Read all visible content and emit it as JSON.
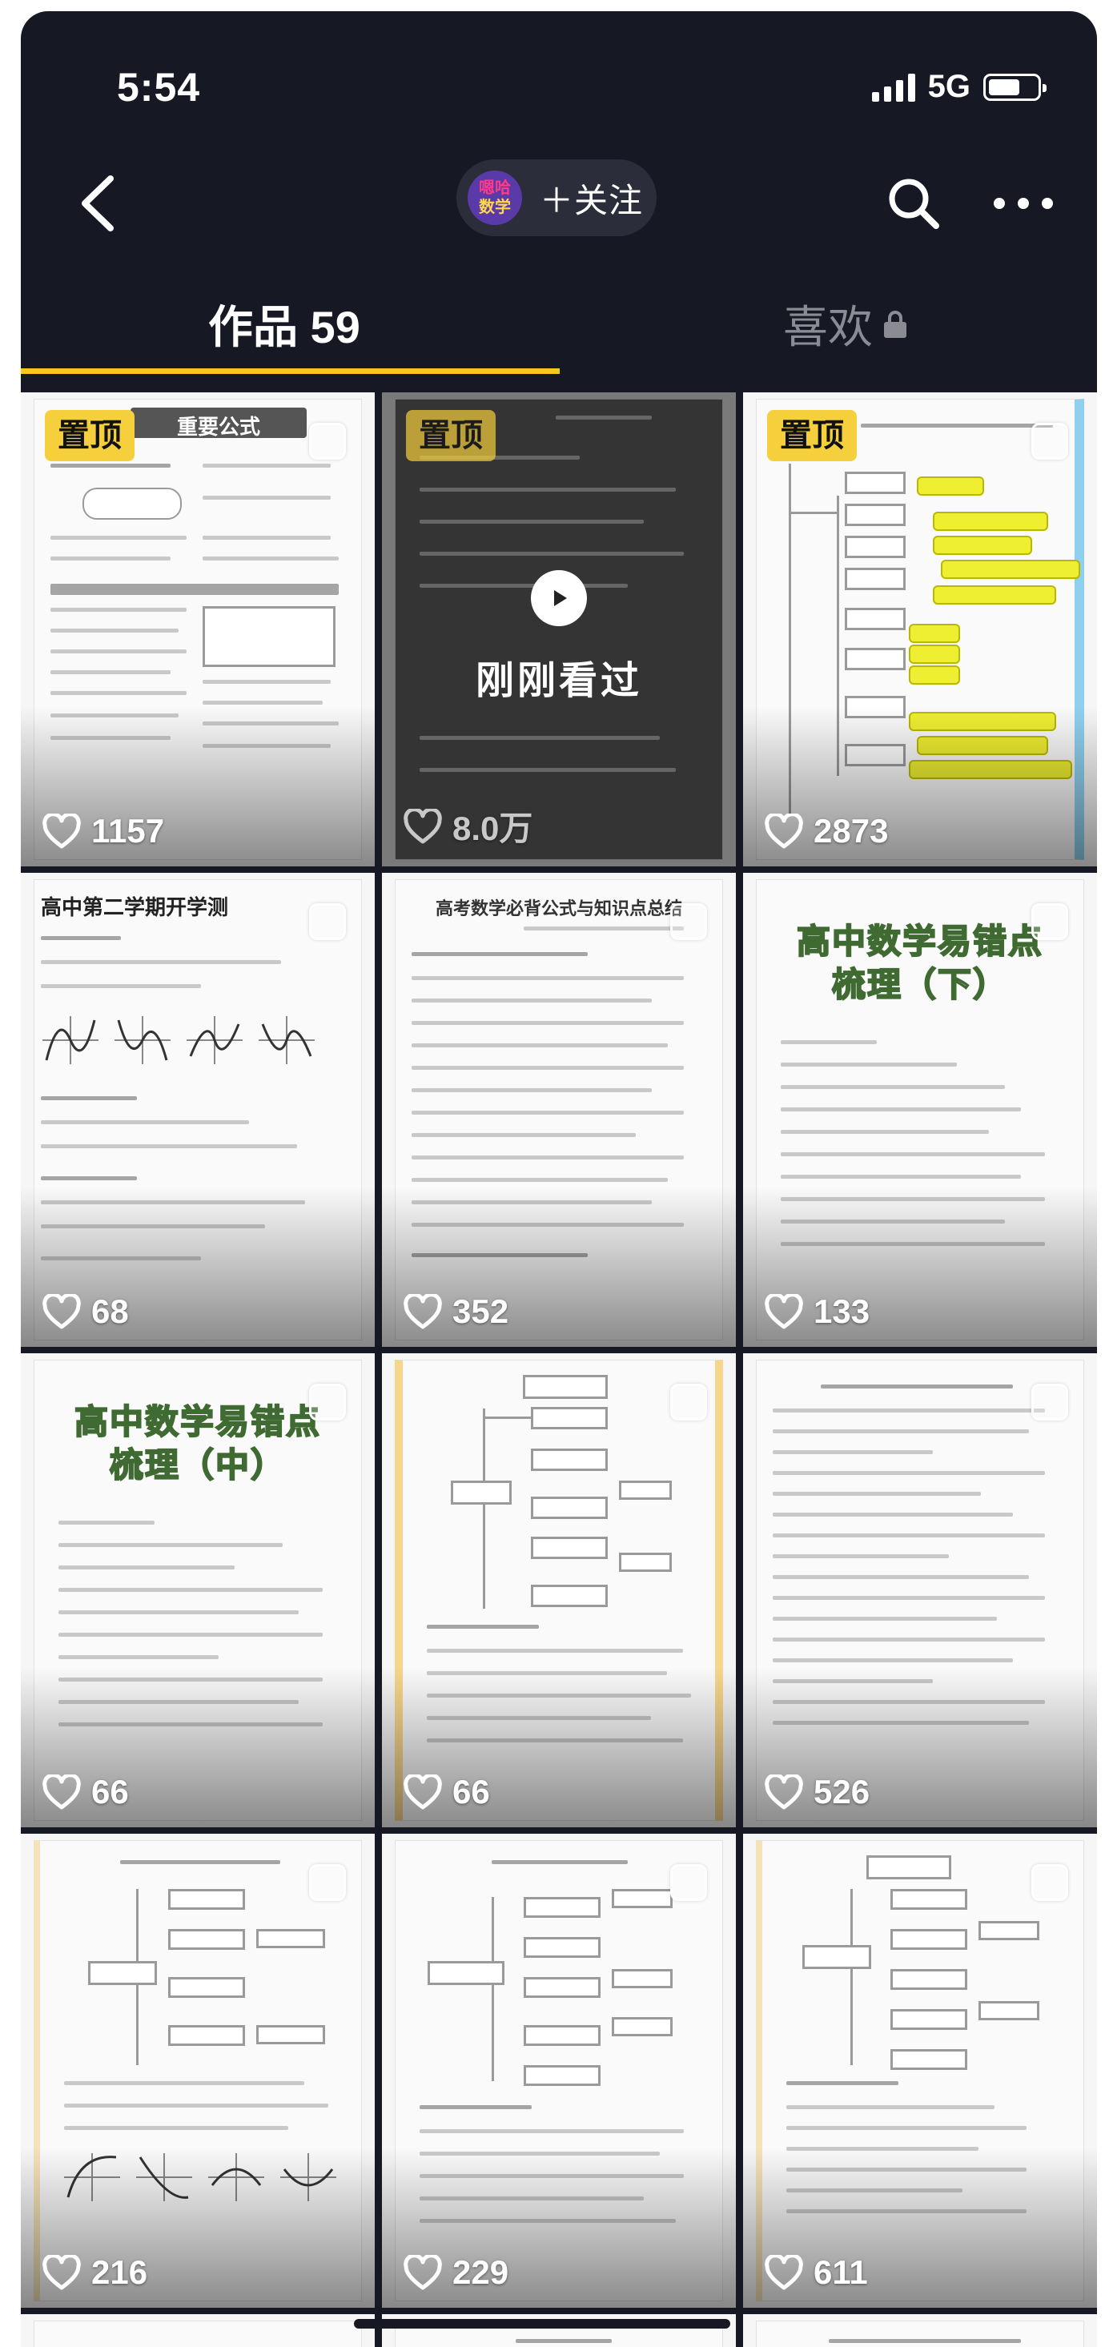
{
  "status_bar": {
    "time": "5:54",
    "network": "5G"
  },
  "header": {
    "avatar_text": [
      "嗯哈",
      "数学"
    ],
    "follow_label": "＋关注"
  },
  "tabs": {
    "works_label": "作品 59",
    "likes_label": "喜欢"
  },
  "tiles": [
    {
      "likes": "1157",
      "pinned": true,
      "pin_label": "置顶",
      "doc_title": "重要公式"
    },
    {
      "likes": "8.0万",
      "pinned": true,
      "pin_label": "置顶",
      "recently_viewed": true,
      "recent_label": "刚刚看过"
    },
    {
      "likes": "2873",
      "pinned": true,
      "pin_label": "置顶"
    },
    {
      "likes": "68",
      "doc_title": "高中第二学期开学测"
    },
    {
      "likes": "352",
      "doc_title": "高考数学必背公式与知识点总结"
    },
    {
      "likes": "133",
      "doc_title": "高中数学易错点",
      "doc_subtitle": "梳理（下）"
    },
    {
      "likes": "66",
      "doc_title": "高中数学易错点",
      "doc_subtitle": "梳理（中）"
    },
    {
      "likes": "66"
    },
    {
      "likes": "526"
    },
    {
      "likes": "216"
    },
    {
      "likes": "229"
    },
    {
      "likes": "611"
    }
  ],
  "colors": {
    "background": "#161823",
    "tab_indicator": "#f7c61f",
    "pin_badge": "#f5cf3c",
    "highlight": "#efef32"
  },
  "icons": [
    "back-arrow-icon",
    "search-icon",
    "more-icon",
    "lock-icon",
    "heart-icon",
    "play-icon"
  ]
}
